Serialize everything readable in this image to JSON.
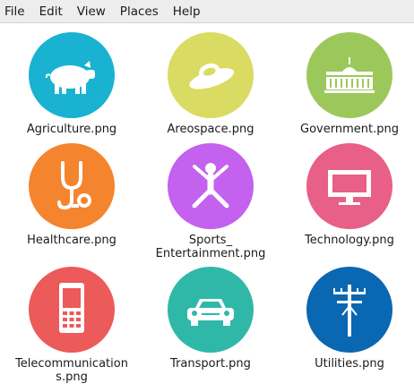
{
  "menubar": {
    "items": [
      "File",
      "Edit",
      "View",
      "Places",
      "Help"
    ]
  },
  "files": [
    {
      "name": "Agriculture.png",
      "label_lines": [
        "Agriculture.png"
      ],
      "icon": "pig-icon",
      "color": "#19b3d1"
    },
    {
      "name": "Areospace.png",
      "label_lines": [
        "Areospace.png"
      ],
      "icon": "ufo-icon",
      "color": "#dadb62"
    },
    {
      "name": "Government.png",
      "label_lines": [
        "Government.png"
      ],
      "icon": "capitol-building-icon",
      "color": "#9cc85b"
    },
    {
      "name": "Healthcare.png",
      "label_lines": [
        "Healthcare.png"
      ],
      "icon": "stethoscope-icon",
      "color": "#f5842e"
    },
    {
      "name": "Sports_ Entertainment.png",
      "label_lines": [
        "Sports_",
        "Entertainment.png"
      ],
      "icon": "jumping-person-icon",
      "color": "#c461ee"
    },
    {
      "name": "Technology.png",
      "label_lines": [
        "Technology.png"
      ],
      "icon": "monitor-icon",
      "color": "#e85f87"
    },
    {
      "name": "Telecommunications.png",
      "label_lines": [
        "Telecommunication",
        "s.png"
      ],
      "icon": "mobile-phone-icon",
      "color": "#ec5a59"
    },
    {
      "name": "Transport.png",
      "label_lines": [
        "Transport.png"
      ],
      "icon": "car-icon",
      "color": "#2fb8a8"
    },
    {
      "name": "Utilities.png",
      "label_lines": [
        "Utilities.png"
      ],
      "icon": "utility-pole-icon",
      "color": "#0a67b2"
    }
  ]
}
